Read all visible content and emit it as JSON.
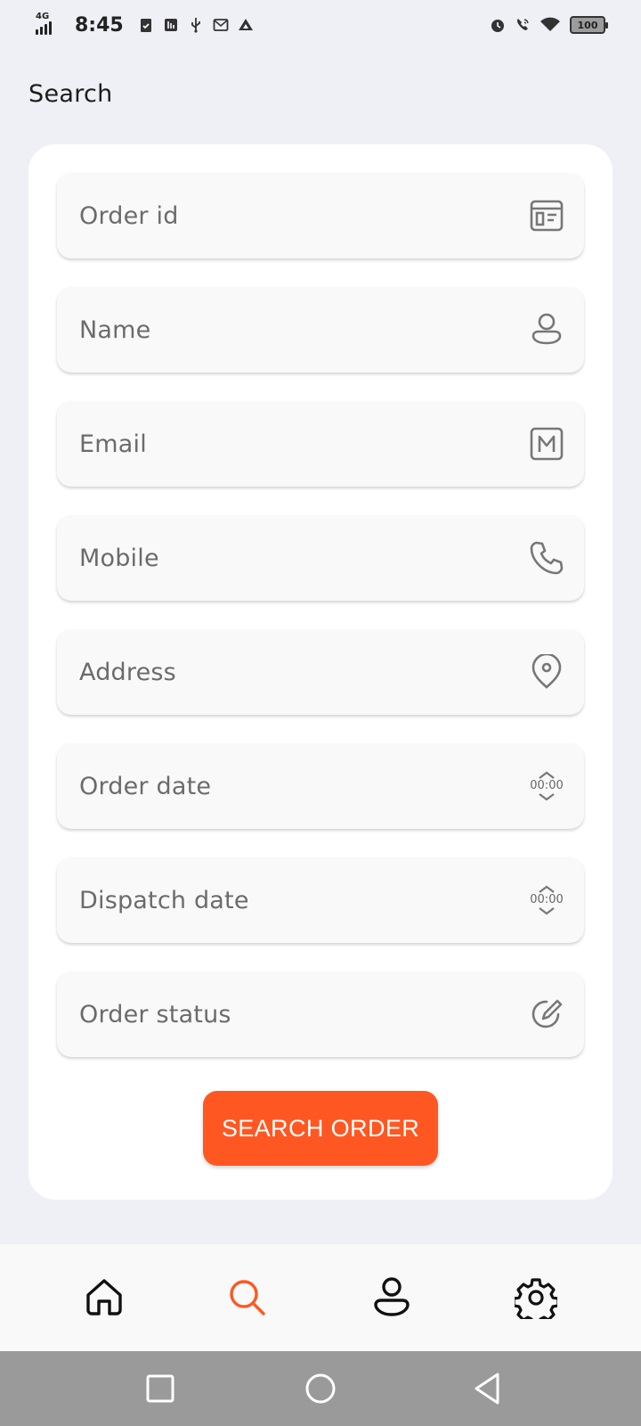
{
  "status_bar": {
    "network": "4G",
    "time": "8:45",
    "battery": "100",
    "left_icons": [
      "clipboard-check-icon",
      "usb-storage-icon",
      "usb-icon",
      "mail-icon",
      "drive-icon"
    ],
    "right_icons": [
      "alarm-icon",
      "wifi-call-icon",
      "wifi-icon",
      "battery-icon"
    ]
  },
  "page": {
    "title": "Search"
  },
  "form": {
    "fields": [
      {
        "label": "Order id",
        "icon": "id-card-icon"
      },
      {
        "label": "Name",
        "icon": "person-icon"
      },
      {
        "label": "Email",
        "icon": "mail-box-icon"
      },
      {
        "label": "Mobile",
        "icon": "phone-icon"
      },
      {
        "label": "Address",
        "icon": "location-pin-icon"
      },
      {
        "label": "Order date",
        "icon": "time-stepper-icon",
        "time": "00:00"
      },
      {
        "label": "Dispatch date",
        "icon": "time-stepper-icon",
        "time": "00:00"
      },
      {
        "label": "Order status",
        "icon": "edit-icon"
      }
    ],
    "submit_label": "SEARCH ORDER"
  },
  "bottom_nav": {
    "items": [
      {
        "name": "home",
        "icon": "home-icon",
        "active": false
      },
      {
        "name": "search",
        "icon": "search-icon",
        "active": true
      },
      {
        "name": "profile",
        "icon": "person-icon",
        "active": false
      },
      {
        "name": "settings",
        "icon": "gear-icon",
        "active": false
      }
    ]
  },
  "colors": {
    "accent": "#ff5722",
    "background": "#eff0f5",
    "card": "#ffffff",
    "field": "#f9f9f9",
    "label": "#6b6b6b"
  }
}
